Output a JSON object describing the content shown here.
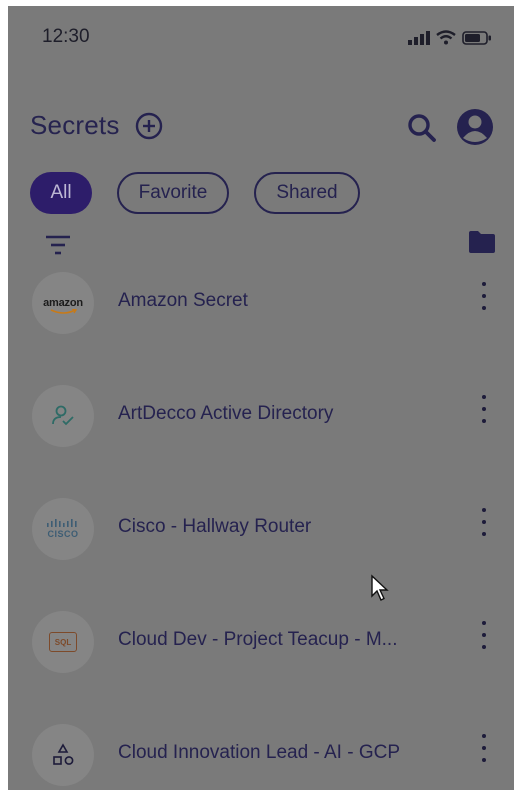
{
  "status_bar": {
    "time": "12:30",
    "icons": [
      "signal-icon",
      "wifi-icon",
      "battery-icon"
    ]
  },
  "header": {
    "title": "Secrets",
    "add_icon": "plus-circle-icon",
    "search_icon": "search-icon",
    "profile_icon": "account-circle-icon"
  },
  "tabs": [
    {
      "label": "All",
      "active": true
    },
    {
      "label": "Favorite",
      "active": false
    },
    {
      "label": "Shared",
      "active": false
    }
  ],
  "toolbar": {
    "filter_icon": "filter-icon",
    "folder_icon": "folder-icon"
  },
  "secrets": [
    {
      "title": "Amazon Secret",
      "logo": "amazon-logo",
      "logo_text": "amazon"
    },
    {
      "title": "ArtDecco Active Directory",
      "logo": "user-check-icon"
    },
    {
      "title": "Cisco - Hallway Router",
      "logo": "cisco-logo",
      "logo_text": "CISCO"
    },
    {
      "title": "Cloud Dev - Project Teacup - M...",
      "logo": "sql-icon",
      "logo_text": "SQL"
    },
    {
      "title": "Cloud Innovation Lead - AI - GCP",
      "logo": "shapes-icon"
    }
  ],
  "colors": {
    "overlay": "#7a7a7a",
    "primary": "#2d1d6a",
    "text": "#25224f"
  }
}
